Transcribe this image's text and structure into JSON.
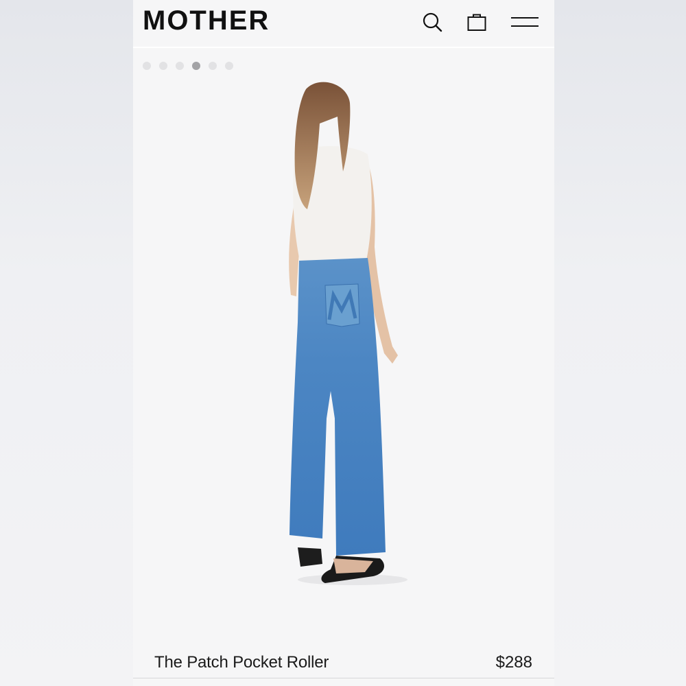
{
  "header": {
    "brand": "MOTHER",
    "icons": {
      "search": "search-icon",
      "bag": "shopping-bag-icon",
      "menu": "hamburger-menu-icon"
    }
  },
  "carousel": {
    "slide_count": 6,
    "active_index": 3
  },
  "product": {
    "name": "The Patch Pocket Roller",
    "price": "$288",
    "image_subject": "model-back-view-wide-leg-jeans"
  },
  "colors": {
    "text": "#111111",
    "background": "#f6f6f7",
    "denim": "#4a84c2",
    "dot_active": "#a3a3a6",
    "dot_inactive": "#e2e2e4"
  }
}
